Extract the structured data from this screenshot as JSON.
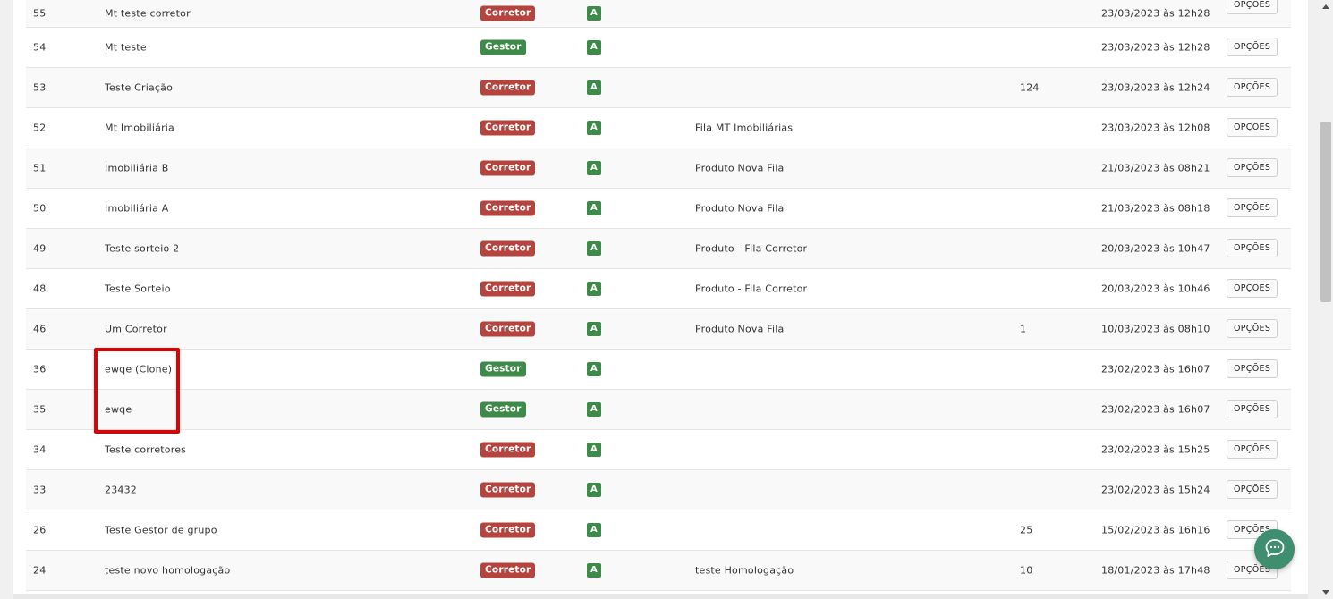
{
  "rows": [
    {
      "id": "55",
      "name": "Mt teste corretor",
      "role": "Corretor",
      "status": "A",
      "queue": "",
      "count": "",
      "date": "23/03/2023 às 12h28"
    },
    {
      "id": "54",
      "name": "Mt teste",
      "role": "Gestor",
      "status": "A",
      "queue": "",
      "count": "",
      "date": "23/03/2023 às 12h28"
    },
    {
      "id": "53",
      "name": "Teste Criação",
      "role": "Corretor",
      "status": "A",
      "queue": "",
      "count": "124",
      "date": "23/03/2023 às 12h24"
    },
    {
      "id": "52",
      "name": "Mt Imobiliária",
      "role": "Corretor",
      "status": "A",
      "queue": "Fila MT Imobiliárias",
      "count": "",
      "date": "23/03/2023 às 12h08"
    },
    {
      "id": "51",
      "name": "Imobiliária B",
      "role": "Corretor",
      "status": "A",
      "queue": "Produto Nova Fila",
      "count": "",
      "date": "21/03/2023 às 08h21"
    },
    {
      "id": "50",
      "name": "Imobiliária A",
      "role": "Corretor",
      "status": "A",
      "queue": "Produto Nova Fila",
      "count": "",
      "date": "21/03/2023 às 08h18"
    },
    {
      "id": "49",
      "name": "Teste sorteio 2",
      "role": "Corretor",
      "status": "A",
      "queue": "Produto - Fila Corretor",
      "count": "",
      "date": "20/03/2023 às 10h47"
    },
    {
      "id": "48",
      "name": "Teste Sorteio",
      "role": "Corretor",
      "status": "A",
      "queue": "Produto - Fila Corretor",
      "count": "",
      "date": "20/03/2023 às 10h46"
    },
    {
      "id": "46",
      "name": "Um Corretor",
      "role": "Corretor",
      "status": "A",
      "queue": "Produto Nova Fila",
      "count": "1",
      "date": "10/03/2023 às 08h10"
    },
    {
      "id": "36",
      "name": "ewqe (Clone)",
      "role": "Gestor",
      "status": "A",
      "queue": "",
      "count": "",
      "date": "23/02/2023 às 16h07"
    },
    {
      "id": "35",
      "name": "ewqe",
      "role": "Gestor",
      "status": "A",
      "queue": "",
      "count": "",
      "date": "23/02/2023 às 16h07"
    },
    {
      "id": "34",
      "name": "Teste corretores",
      "role": "Corretor",
      "status": "A",
      "queue": "",
      "count": "",
      "date": "23/02/2023 às 15h25"
    },
    {
      "id": "33",
      "name": "23432",
      "role": "Corretor",
      "status": "A",
      "queue": "",
      "count": "",
      "date": "23/02/2023 às 15h24"
    },
    {
      "id": "26",
      "name": "Teste Gestor de grupo",
      "role": "Corretor",
      "status": "A",
      "queue": "",
      "count": "25",
      "date": "15/02/2023 às 16h16"
    },
    {
      "id": "24",
      "name": "teste novo homologação",
      "role": "Corretor",
      "status": "A",
      "queue": "teste Homologação",
      "count": "10",
      "date": "18/01/2023 às 17h48"
    }
  ],
  "options_label": "OPÇÕES",
  "colors": {
    "corretor_tag": "#b5443e",
    "gestor_tag": "#3d8a49",
    "status_tag": "#3d8a49",
    "highlight": "#e30000",
    "chat_button": "#3e8e6f"
  },
  "icons": {
    "chat": "chat-bubble-icon",
    "scroll_up": "scroll-up-arrow-icon",
    "scroll_down": "scroll-down-arrow-icon"
  }
}
